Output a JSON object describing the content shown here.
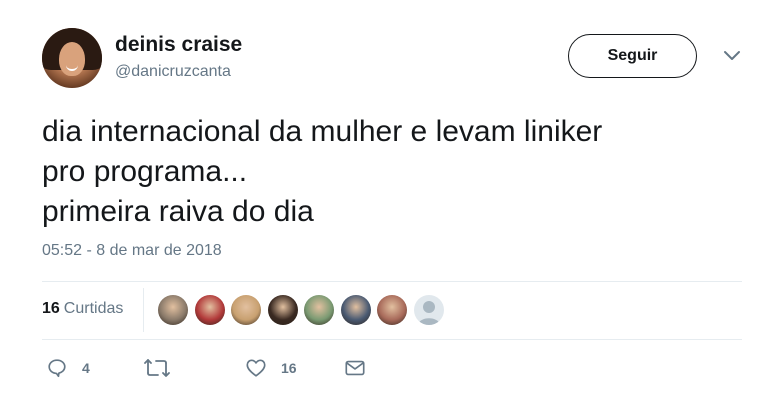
{
  "user": {
    "name": "deinis craise",
    "handle": "@danicruzcanta"
  },
  "follow_label": "Seguir",
  "tweet": {
    "lines": [
      "dia internacional da mulher e levam liniker",
      "pro programa...",
      "primeira raiva do dia"
    ],
    "timestamp": "05:52 - 8 de mar de 2018"
  },
  "likes": {
    "count": "16",
    "label": "Curtidas",
    "avatars": [
      {
        "icon": "liker-avatar",
        "bg": "#8a7a6a"
      },
      {
        "icon": "liker-avatar",
        "bg": "#b23a3a"
      },
      {
        "icon": "liker-avatar",
        "bg": "#c8a070"
      },
      {
        "icon": "liker-avatar",
        "bg": "#3a2a22"
      },
      {
        "icon": "liker-avatar",
        "bg": "#7a9a72"
      },
      {
        "icon": "liker-avatar",
        "bg": "#4a5a72"
      },
      {
        "icon": "liker-avatar",
        "bg": "#a86a5a"
      },
      {
        "icon": "default-avatar",
        "bg": "#aab8c2"
      }
    ]
  },
  "actions": {
    "reply_count": "4",
    "retweet_count": "",
    "like_count": "16"
  },
  "colors": {
    "text": "#14171a",
    "muted": "#657786",
    "divider": "#e6ecf0"
  }
}
